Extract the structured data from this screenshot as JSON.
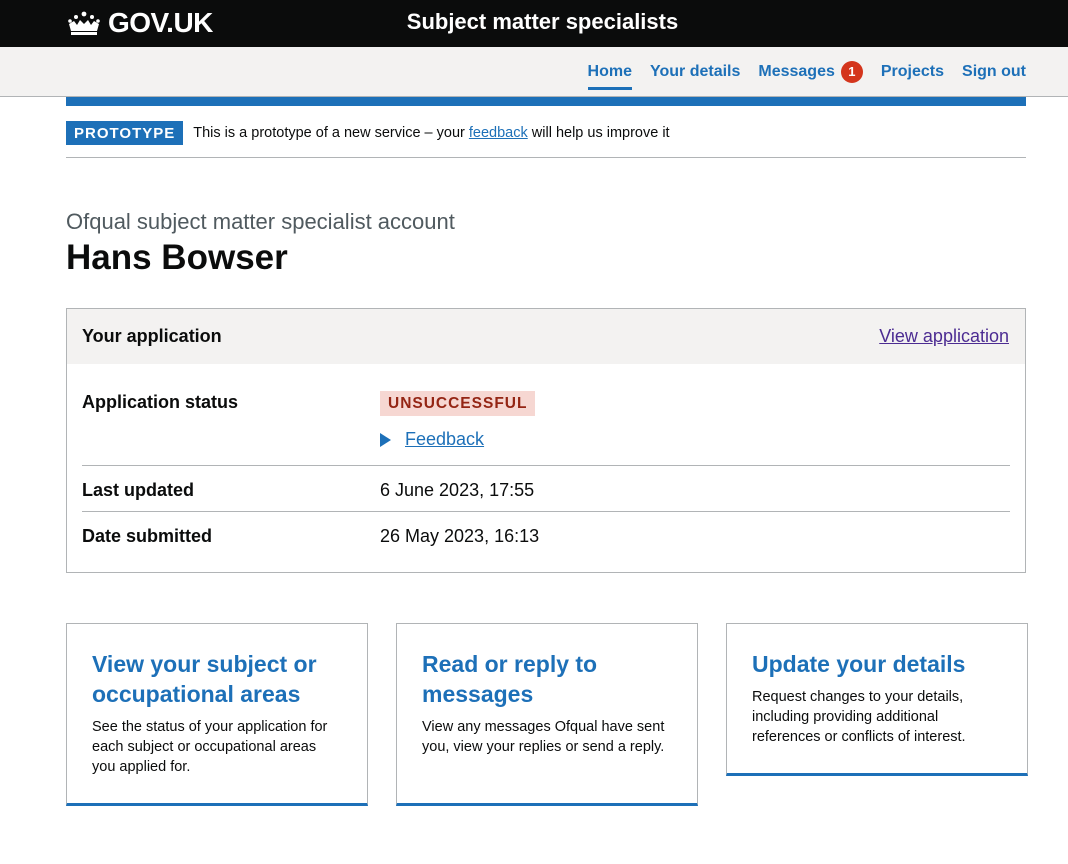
{
  "header": {
    "logo_text": "GOV.UK",
    "service_name": "Subject matter specialists"
  },
  "nav": {
    "items": [
      {
        "label": "Home",
        "active": true
      },
      {
        "label": "Your details"
      },
      {
        "label": "Messages",
        "badge": "1"
      },
      {
        "label": "Projects"
      },
      {
        "label": "Sign out"
      }
    ]
  },
  "phase_banner": {
    "tag": "PROTOTYPE",
    "text_before": "This is a prototype of a new service – your ",
    "link": "feedback",
    "text_after": " will help us improve it"
  },
  "page": {
    "caption": "Ofqual subject matter specialist account",
    "title": "Hans Bowser"
  },
  "application_card": {
    "title": "Your application",
    "action_link": "View application",
    "rows": [
      {
        "key": "Application status",
        "status_tag": "UNSUCCESSFUL",
        "details_link": "Feedback"
      },
      {
        "key": "Last updated",
        "value": "6 June 2023, 17:55"
      },
      {
        "key": "Date submitted",
        "value": "26 May 2023, 16:13"
      }
    ]
  },
  "tiles": [
    {
      "title": "View your subject or occupational areas",
      "description": "See the status of your application for each subject or occupational areas you applied for."
    },
    {
      "title": "Read or reply to messages",
      "description": "View any messages Ofqual have sent you, view your replies or send a reply."
    },
    {
      "title": "Update your details",
      "description": "Request changes to your details, including providing additional references or conflicts of interest."
    }
  ],
  "colors": {
    "header_bg": "#0b0c0c",
    "link_blue": "#1d70b8",
    "visited_link": "#4c2c92",
    "badge_red": "#d4351c",
    "tag_red_bg": "#f6d7d2",
    "tag_red_text": "#942514"
  }
}
